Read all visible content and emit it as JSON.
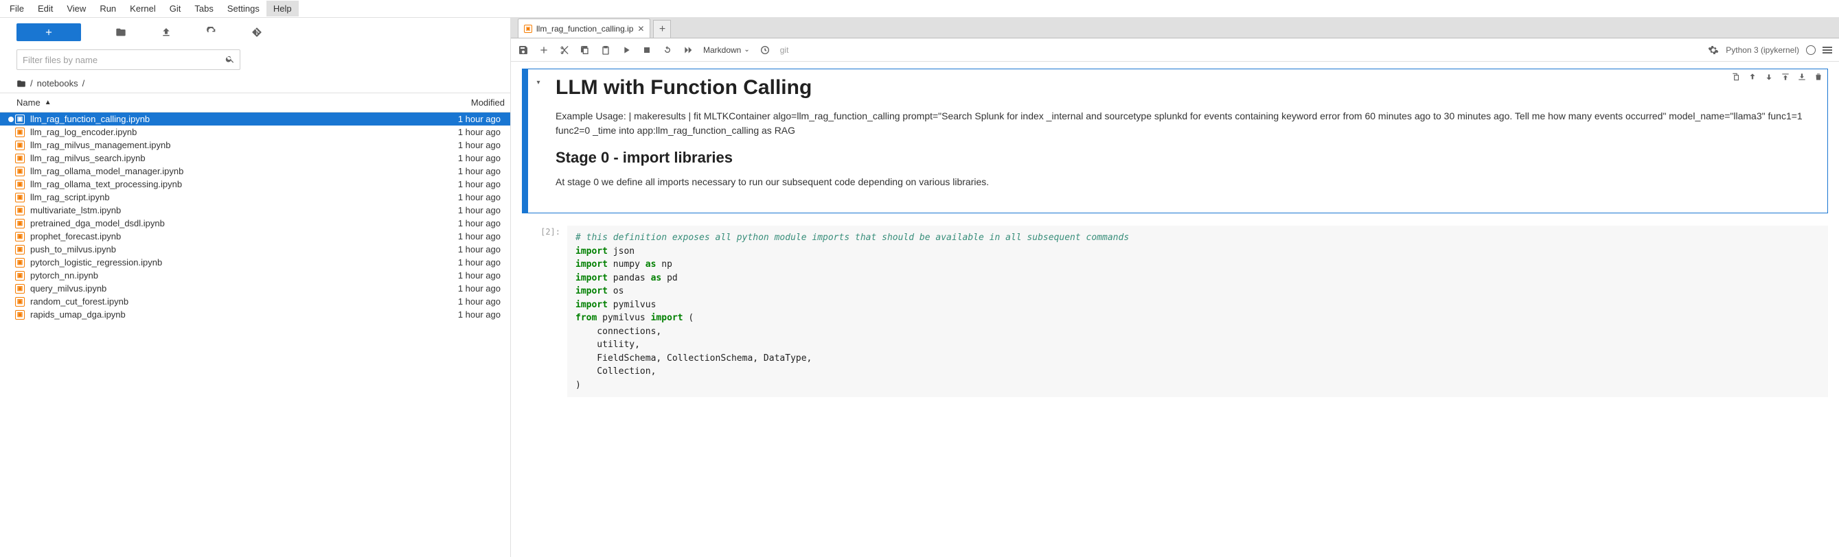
{
  "menubar": [
    "File",
    "Edit",
    "View",
    "Run",
    "Kernel",
    "Git",
    "Tabs",
    "Settings",
    "Help"
  ],
  "menubar_active": "Help",
  "sidebar": {
    "filter_placeholder": "Filter files by name",
    "breadcrumb": [
      "/",
      "notebooks",
      "/"
    ],
    "header": {
      "name": "Name",
      "modified": "Modified"
    },
    "files": [
      {
        "name": "llm_rag_function_calling.ipynb",
        "modified": "1 hour ago",
        "selected": true,
        "running": true
      },
      {
        "name": "llm_rag_log_encoder.ipynb",
        "modified": "1 hour ago"
      },
      {
        "name": "llm_rag_milvus_management.ipynb",
        "modified": "1 hour ago"
      },
      {
        "name": "llm_rag_milvus_search.ipynb",
        "modified": "1 hour ago"
      },
      {
        "name": "llm_rag_ollama_model_manager.ipynb",
        "modified": "1 hour ago"
      },
      {
        "name": "llm_rag_ollama_text_processing.ipynb",
        "modified": "1 hour ago"
      },
      {
        "name": "llm_rag_script.ipynb",
        "modified": "1 hour ago"
      },
      {
        "name": "multivariate_lstm.ipynb",
        "modified": "1 hour ago"
      },
      {
        "name": "pretrained_dga_model_dsdl.ipynb",
        "modified": "1 hour ago"
      },
      {
        "name": "prophet_forecast.ipynb",
        "modified": "1 hour ago"
      },
      {
        "name": "push_to_milvus.ipynb",
        "modified": "1 hour ago"
      },
      {
        "name": "pytorch_logistic_regression.ipynb",
        "modified": "1 hour ago"
      },
      {
        "name": "pytorch_nn.ipynb",
        "modified": "1 hour ago"
      },
      {
        "name": "query_milvus.ipynb",
        "modified": "1 hour ago"
      },
      {
        "name": "random_cut_forest.ipynb",
        "modified": "1 hour ago"
      },
      {
        "name": "rapids_umap_dga.ipynb",
        "modified": "1 hour ago"
      }
    ]
  },
  "tab": {
    "label": "llm_rag_function_calling.ip"
  },
  "nb_toolbar": {
    "celltype": "Markdown",
    "git": "git"
  },
  "kernel": {
    "name": "Python 3 (ipykernel)"
  },
  "md": {
    "h1": "LLM with Function Calling",
    "p1": "Example Usage: | makeresults | fit MLTKContainer algo=llm_rag_function_calling prompt=\"Search Splunk for index _internal and sourcetype splunkd for events containing keyword error from 60 minutes ago to 30 minutes ago. Tell me how many events occurred\" model_name=\"llama3\" func1=1 func2=0 _time into app:llm_rag_function_calling as RAG",
    "h2": "Stage 0 - import libraries",
    "p2": "At stage 0 we define all imports necessary to run our subsequent code depending on various libraries."
  },
  "code": {
    "prompt": "[2]:",
    "lines": [
      {
        "t": "comment",
        "text": "# this definition exposes all python module imports that should be available in all subsequent commands"
      },
      {
        "t": "import1",
        "kw": "import",
        "mod": "json"
      },
      {
        "t": "import_as",
        "kw": "import",
        "mod": "numpy",
        "as": "as",
        "alias": "np"
      },
      {
        "t": "import_as",
        "kw": "import",
        "mod": "pandas",
        "as": "as",
        "alias": "pd"
      },
      {
        "t": "import1",
        "kw": "import",
        "mod": "os"
      },
      {
        "t": "import1",
        "kw": "import",
        "mod": "pymilvus"
      },
      {
        "t": "from_import",
        "from": "from",
        "mod": "pymilvus",
        "imp": "import",
        "paren": "("
      },
      {
        "t": "indent",
        "text": "    connections,"
      },
      {
        "t": "indent",
        "text": "    utility,"
      },
      {
        "t": "indent",
        "text": "    FieldSchema, CollectionSchema, DataType,"
      },
      {
        "t": "indent",
        "text": "    Collection,"
      },
      {
        "t": "indent",
        "text": ")"
      }
    ]
  }
}
